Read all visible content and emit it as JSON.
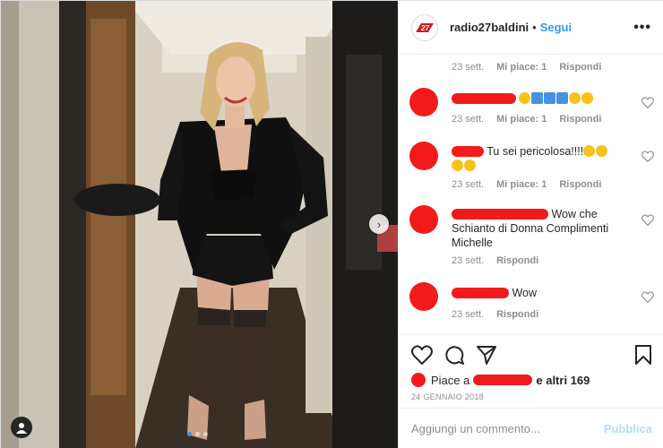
{
  "colors": {
    "accent": "#3897f0",
    "redact": "#f21a1a",
    "muted": "#8e8e8e"
  },
  "post": {
    "username": "radio27baldini",
    "follow_label": "Segui",
    "separator": "•",
    "more_icon": "ellipsis-icon"
  },
  "comments": [
    {
      "time": "23 sett.",
      "likes": "",
      "reply": "Rispondi",
      "text": "",
      "partial": true
    },
    {
      "time": "23 sett.",
      "likes": "Mi piace: 1",
      "reply": "Rispondi",
      "text": ""
    },
    {
      "time": "23 sett.",
      "likes": "Mi piace: 1",
      "reply": "Rispondi",
      "text": "Tu sei pericolosa!!!!"
    },
    {
      "time": "23 sett.",
      "likes": "",
      "reply": "Rispondi",
      "text": "Wow che Schianto di Donna Complimenti Michelle"
    },
    {
      "time": "23 sett.",
      "likes": "",
      "reply": "Rispondi",
      "text": "Wow"
    }
  ],
  "first_meta": {
    "time": "23 sett.",
    "likes": "Mi piace: 1",
    "reply": "Rispondi"
  },
  "likes_line": {
    "prefix": "Piace a",
    "suffix": "e altri 169"
  },
  "date": "24 GENNAIO 2018",
  "add_comment": {
    "placeholder": "Aggiungi un commento...",
    "publish": "Pubblica"
  }
}
